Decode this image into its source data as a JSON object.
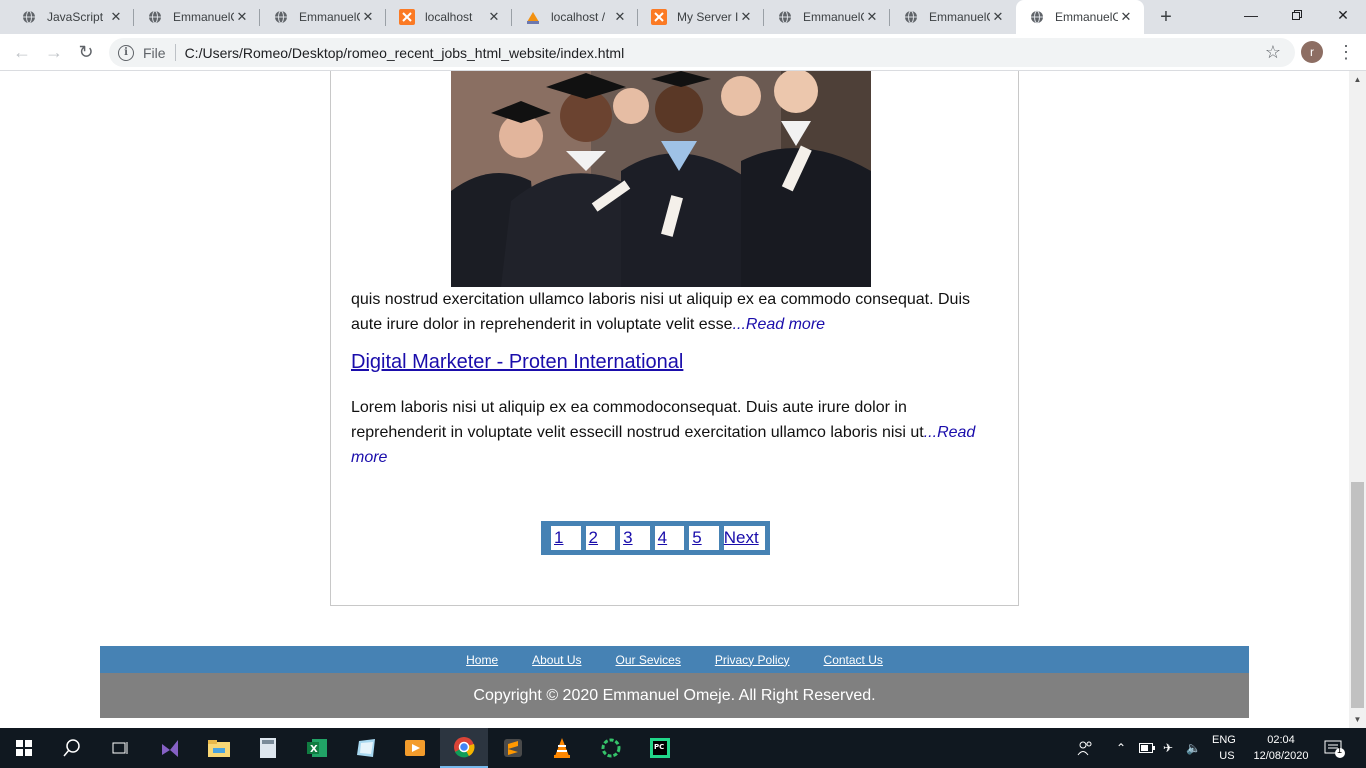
{
  "browser": {
    "tabs": [
      {
        "title": "JavaScript",
        "icon": "globe-icon"
      },
      {
        "title": "EmmanuelC",
        "icon": "globe-icon"
      },
      {
        "title": "EmmanuelC",
        "icon": "globe-icon"
      },
      {
        "title": "localhost",
        "icon": "xampp-icon"
      },
      {
        "title": "localhost /",
        "icon": "phpmyadmin-icon"
      },
      {
        "title": "My Server I",
        "icon": "xampp-icon"
      },
      {
        "title": "EmmanuelC",
        "icon": "globe-icon"
      },
      {
        "title": "EmmanuelC",
        "icon": "globe-icon"
      },
      {
        "title": "EmmanuelC",
        "icon": "globe-icon",
        "active": true
      }
    ],
    "scheme_label": "File",
    "url": "C:/Users/Romeo/Desktop/romeo_recent_jobs_html_website/index.html",
    "profile_initial": "r"
  },
  "page": {
    "para1": "quis nostrud exercitation ullamco laboris nisi ut aliquip ex ea commodo consequat. Duis aute irure dolor in reprehenderit in voluptate velit esse",
    "para1_more": "...Read more",
    "job_title": "Digital Marketer - Proten International",
    "para2": "Lorem laboris nisi ut aliquip ex ea commodoconsequat. Duis aute irure dolor in reprehenderit in voluptate velit essecill nostrud exercitation ullamco laboris nisi ut",
    "para2_more": "...Read more",
    "pagination": [
      "1",
      "2",
      "3",
      "4",
      "5"
    ],
    "pagination_next": "Next",
    "footer_links": [
      "Home",
      "About Us",
      "Our Sevices",
      "Privacy Policy",
      "Contact Us"
    ],
    "copyright": "Copyright © 2020 Emmanuel Omeje. All Right Reserved."
  },
  "taskbar": {
    "apps": [
      "windows-start-icon",
      "search-icon",
      "task-view-icon",
      "visual-studio-icon",
      "file-explorer-icon",
      "calculator-icon",
      "excel-icon",
      "notes-icon",
      "media-player-icon",
      "chrome-icon",
      "sublime-text-icon",
      "vlc-icon",
      "loader-app-icon",
      "pycharm-icon"
    ],
    "lang_top": "ENG",
    "lang_bottom": "US",
    "time": "02:04",
    "date": "12/08/2020",
    "notification_count": "1"
  },
  "colors": {
    "accent": "#4682b4",
    "footer_gray": "#808080",
    "link": "#1a0dab"
  }
}
